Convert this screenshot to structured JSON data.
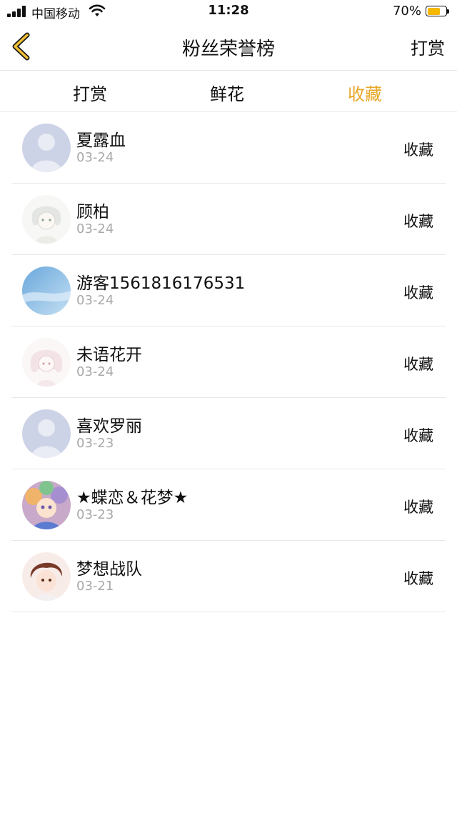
{
  "status_bar": {
    "carrier": "中国移动",
    "time": "11:28",
    "battery_percent": "70%",
    "battery_level": 0.7
  },
  "nav": {
    "back_icon": "chevron-left-icon",
    "title": "粉丝荣誉榜",
    "right_label": "打赏"
  },
  "tabs": [
    {
      "label": "打赏",
      "active": false
    },
    {
      "label": "鲜花",
      "active": false
    },
    {
      "label": "收藏",
      "active": true
    }
  ],
  "colors": {
    "accent": "#e8a726",
    "battery": "#f5b800"
  },
  "rows": [
    {
      "name": "夏露血",
      "date": "03-24",
      "type": "收藏",
      "avatar": "default-avatar"
    },
    {
      "name": "顾柏",
      "date": "03-24",
      "type": "收藏",
      "avatar": "anime-sketch-avatar"
    },
    {
      "name": "游客1561816176531",
      "date": "03-24",
      "type": "收藏",
      "avatar": "sky-avatar"
    },
    {
      "name": "未语花开",
      "date": "03-24",
      "type": "收藏",
      "avatar": "anime-sketch-avatar"
    },
    {
      "name": "喜欢罗丽",
      "date": "03-23",
      "type": "收藏",
      "avatar": "default-avatar"
    },
    {
      "name": "★蝶恋＆花梦★",
      "date": "03-23",
      "type": "收藏",
      "avatar": "colorful-anime-avatar"
    },
    {
      "name": "梦想战队",
      "date": "03-21",
      "type": "收藏",
      "avatar": "anime-boy-avatar"
    }
  ]
}
